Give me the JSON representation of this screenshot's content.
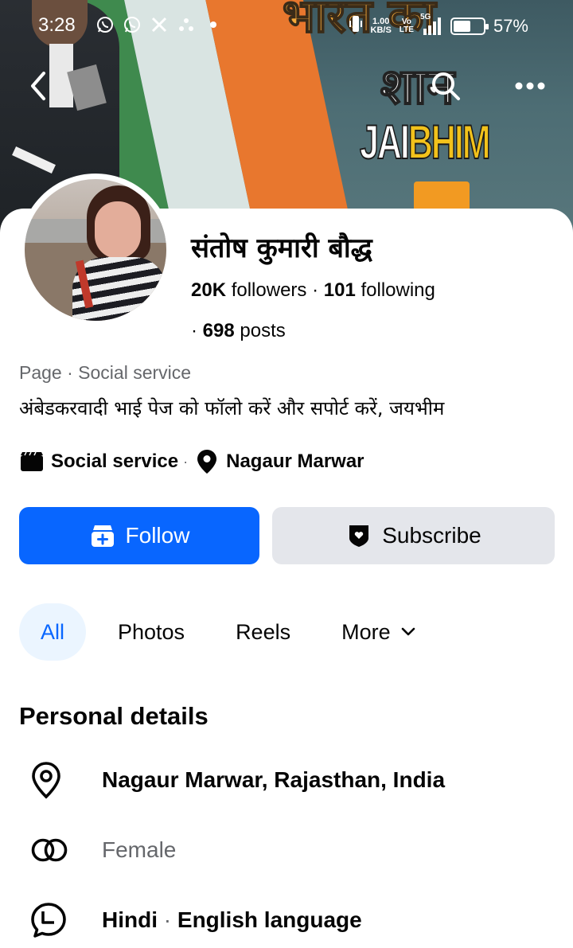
{
  "status_bar": {
    "time": "3:28",
    "net_speed_value": "1.00",
    "net_speed_unit": "KB/S",
    "volte_top": "Vo",
    "volte_bottom": "LTE",
    "network": "5G",
    "battery_percent": "57%",
    "battery_level": 0.57,
    "notification_icons": [
      "whatsapp-icon",
      "whatsapp-icon",
      "x-icon",
      "app-icon",
      "dot-icon"
    ]
  },
  "cover": {
    "hindi_top": "भारत का",
    "hindi_mid": "शान",
    "jai": "JAI",
    "bhim": "BHIM"
  },
  "profile": {
    "name": "संतोष कुमारी बौद्ध",
    "followers_count": "20K",
    "followers_label": "followers",
    "following_count": "101",
    "following_label": "following",
    "posts_count": "698",
    "posts_label": "posts",
    "category_line": "Page · Social service",
    "bio": "अंबेडकरवादी भाई पेज को फॉलो करें और सपोर्ट करें, जयभीम",
    "meta_category": "Social service",
    "meta_location": "Nagaur Marwar"
  },
  "actions": {
    "follow_label": "Follow",
    "subscribe_label": "Subscribe",
    "follow_color": "#0866ff"
  },
  "tabs": [
    {
      "label": "All",
      "active": true
    },
    {
      "label": "Photos",
      "active": false
    },
    {
      "label": "Reels",
      "active": false
    },
    {
      "label": "More",
      "active": false
    }
  ],
  "personal_details": {
    "title": "Personal details",
    "location": "Nagaur Marwar, Rajasthan, India",
    "gender": "Female",
    "language_first": "Hindi",
    "language_second": "English language"
  },
  "icons": {
    "back": "chevron-left-icon",
    "search": "search-icon",
    "more": "more-dots-icon",
    "category": "clapperboard-icon",
    "location": "map-pin-icon",
    "follow": "follow-page-icon",
    "subscribe": "shield-heart-icon",
    "detail_location": "map-pin-outline-icon",
    "detail_gender": "gender-rings-icon",
    "detail_language": "speech-bubble-icon"
  }
}
